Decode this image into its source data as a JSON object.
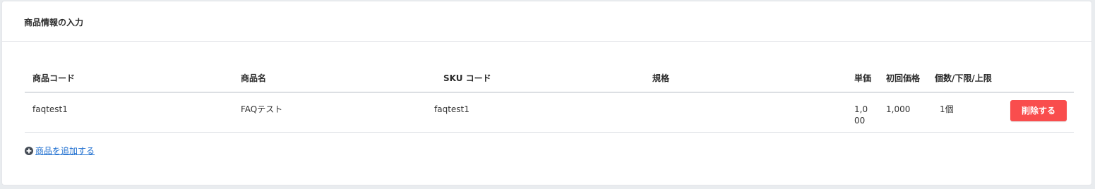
{
  "card": {
    "title": "商品情報の入力"
  },
  "table": {
    "headers": {
      "product_code": "商品コード",
      "product_name": "商品名",
      "sku_code": "SKU コード",
      "spec": "規格",
      "unit_price": "単価",
      "first_price": "初回価格",
      "quantity_limits": "個数/下限/上限"
    },
    "rows": [
      {
        "product_code": "faqtest1",
        "product_name": "FAQテスト",
        "sku_code": "faqtest1",
        "spec": "",
        "unit_price": "1,000",
        "first_price": "1,000",
        "quantity": "1個",
        "delete_label": "削除する"
      }
    ]
  },
  "add_product": {
    "label": "商品を追加する",
    "icon": "plus-circle-icon"
  },
  "colors": {
    "delete_button": "#f94d4d",
    "link": "#1f6fd0"
  }
}
